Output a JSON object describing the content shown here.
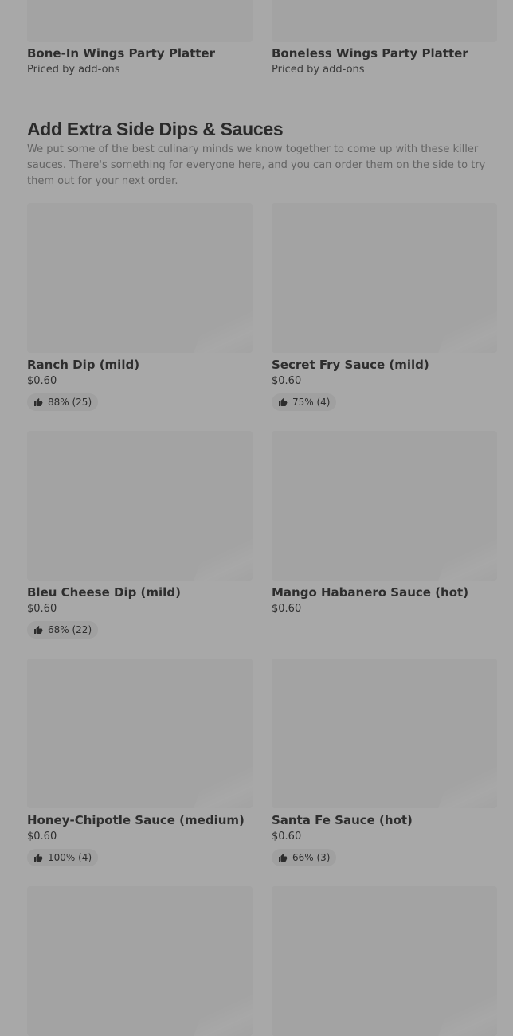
{
  "top_items": [
    {
      "name": "Bone-In Wings Party Platter",
      "sub": "Priced by add-ons"
    },
    {
      "name": "Boneless Wings Party Platter",
      "sub": "Priced by add-ons"
    }
  ],
  "section": {
    "title": "Add Extra Side Dips & Sauces",
    "description": "We put some of the best culinary minds we know together to come up with these killer sauces. There's something for everyone here, and you can order them on the side to try them out for your next order."
  },
  "items": [
    {
      "name": "Ranch Dip (mild)",
      "price": "$0.60",
      "rating": "88% (25)"
    },
    {
      "name": "Secret Fry Sauce (mild)",
      "price": "$0.60",
      "rating": "75% (4)"
    },
    {
      "name": "Bleu Cheese Dip (mild)",
      "price": "$0.60",
      "rating": "68% (22)"
    },
    {
      "name": "Mango Habanero Sauce (hot)",
      "price": "$0.60",
      "rating": null
    },
    {
      "name": "Honey-Chipotle Sauce (medium)",
      "price": "$0.60",
      "rating": "100% (4)"
    },
    {
      "name": "Santa Fe Sauce (hot)",
      "price": "$0.60",
      "rating": "66% (3)"
    }
  ],
  "icons": {
    "rating_icon": "thumbs-up-icon"
  },
  "colors": {
    "overlay_background": "#a8a8a8",
    "thumbnail_placeholder": "#a3a3a3",
    "rating_pill": "#a0a0a0"
  }
}
